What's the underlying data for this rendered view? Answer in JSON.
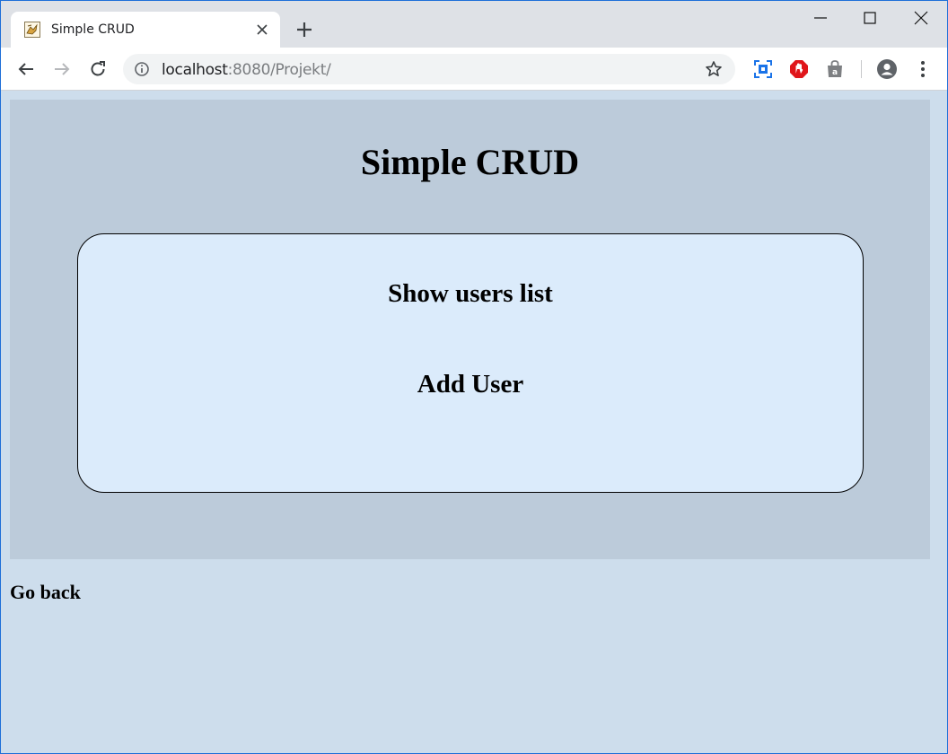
{
  "browser": {
    "tab": {
      "title": "Simple CRUD",
      "favicon": "tomcat-favicon-icon"
    },
    "address": {
      "host": "localhost",
      "rest": ":8080/Projekt/"
    },
    "accent_color": "#1e6fd8",
    "extensions": [
      "screen-capture-icon",
      "adblock-icon",
      "shopping-bag-icon"
    ]
  },
  "page": {
    "title": "Simple CRUD",
    "menu": {
      "items": [
        {
          "label": "Show users list"
        },
        {
          "label": "Add User"
        }
      ]
    },
    "go_back": "Go back",
    "colors": {
      "background": "#cdddec",
      "header_panel": "#bccbda",
      "menu_box": "#dbebfb"
    }
  }
}
